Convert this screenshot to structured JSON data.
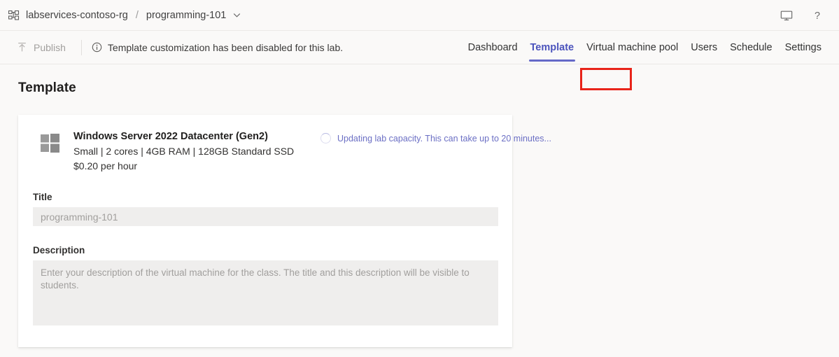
{
  "header": {
    "resource_group": "labservices-contoso-rg",
    "separator": "/",
    "lab_name": "programming-101",
    "rg_icon": "resource-group-icon",
    "chevron_icon": "chevron-down-icon",
    "display_icon": "monitor-icon",
    "help_icon": "help-question-icon"
  },
  "command_bar": {
    "publish_label": "Publish",
    "publish_icon": "publish-upload-icon",
    "info_icon": "info-circle-icon",
    "disabled_message": "Template customization has been disabled for this lab.",
    "tabs": [
      {
        "label": "Dashboard",
        "active": false
      },
      {
        "label": "Template",
        "active": true
      },
      {
        "label": "Virtual machine pool",
        "active": false
      },
      {
        "label": "Users",
        "active": false
      },
      {
        "label": "Schedule",
        "active": false
      },
      {
        "label": "Settings",
        "active": false
      }
    ],
    "active_tab": "Template"
  },
  "page": {
    "title": "Template"
  },
  "template_card": {
    "vm_icon": "windows-logo-icon",
    "vm_title": "Windows Server 2022 Datacenter (Gen2)",
    "vm_specs": "Small | 2 cores | 4GB RAM | 128GB Standard SSD",
    "vm_price": "$0.20 per hour",
    "status_icon": "spinner-icon",
    "status_text": "Updating lab capacity. This can take up to 20 minutes...",
    "title_field": {
      "label": "Title",
      "value": "programming-101"
    },
    "description_field": {
      "label": "Description",
      "value": "",
      "placeholder": "Enter your description of the virtual machine for the class. The title and this description will be visible to students."
    }
  },
  "colors": {
    "accent": "#5b5fc7",
    "annotation": "#e8241a",
    "page_background": "#faf9f8",
    "card_background": "#ffffff",
    "input_background": "#efeeed"
  }
}
